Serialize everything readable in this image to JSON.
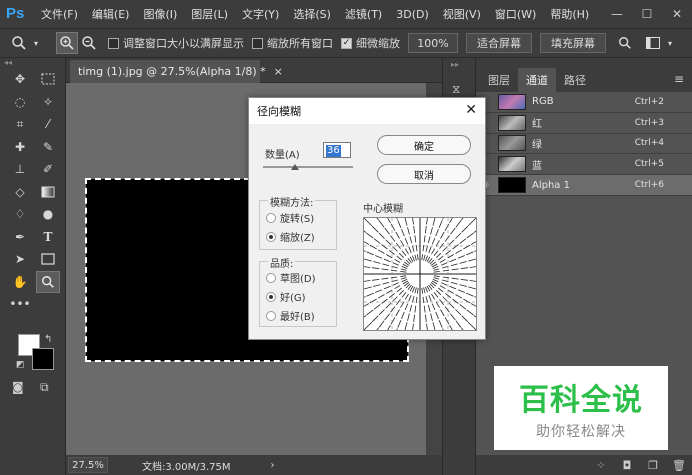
{
  "app": {
    "logo": "Ps",
    "menu": [
      "文件(F)",
      "编辑(E)",
      "图像(I)",
      "图层(L)",
      "文字(Y)",
      "选择(S)",
      "滤镜(T)",
      "3D(D)",
      "视图(V)",
      "窗口(W)",
      "帮助(H)"
    ],
    "window_controls": {
      "minimize": "—",
      "maximize": "☐",
      "close": "✕"
    }
  },
  "options_bar": {
    "resize_windows_label": "调整窗口大小以满屏显示",
    "resize_windows_checked": false,
    "zoom_all_label": "缩放所有窗口",
    "zoom_all_checked": false,
    "scrubby_zoom_label": "细微缩放",
    "scrubby_zoom_checked": true,
    "zoom_value": "100%",
    "fit_screen_label": "适合屏幕",
    "fill_screen_label": "填充屏幕"
  },
  "document": {
    "tab_title": "timg (1).jpg @ 27.5%(Alpha 1/8) *",
    "tab_close": "×",
    "zoom": "27.5%",
    "doc_size": "文档:3.00M/3.75M",
    "status_arrow": "›"
  },
  "channels_panel": {
    "tabs": [
      "图层",
      "通道",
      "路径"
    ],
    "active_tab": "通道",
    "menu_glyph": "≡",
    "channels": [
      {
        "name": "RGB",
        "shortcut": "Ctrl+2",
        "selected": false
      },
      {
        "name": "红",
        "shortcut": "Ctrl+3",
        "selected": false
      },
      {
        "name": "绿",
        "shortcut": "Ctrl+4",
        "selected": false
      },
      {
        "name": "蓝",
        "shortcut": "Ctrl+5",
        "selected": false
      },
      {
        "name": "Alpha 1",
        "shortcut": "Ctrl+6",
        "selected": true
      }
    ]
  },
  "dialog": {
    "title": "径向模糊",
    "close_glyph": "✕",
    "amount_label": "数量(A)",
    "amount_value": "36",
    "amount_fraction": 0.36,
    "ok_label": "确定",
    "cancel_label": "取消",
    "blur_method_label": "模糊方法:",
    "blur_methods": [
      {
        "label": "旋转(S)",
        "selected": false
      },
      {
        "label": "缩放(Z)",
        "selected": true
      }
    ],
    "quality_label": "品质:",
    "qualities": [
      {
        "label": "草图(D)",
        "selected": false
      },
      {
        "label": "好(G)",
        "selected": true
      },
      {
        "label": "最好(B)",
        "selected": false
      }
    ],
    "center_label": "中心模糊"
  },
  "watermark": {
    "title": "百科全说",
    "subtitle": "助你轻松解决"
  },
  "colors": {
    "foreground": "#ffffff",
    "background": "#000000",
    "ui_dark": "#3c3c3c",
    "ui_mid": "#535353",
    "ps_blue": "#3aa5f2",
    "watermark_green": "#2cbf4a"
  }
}
